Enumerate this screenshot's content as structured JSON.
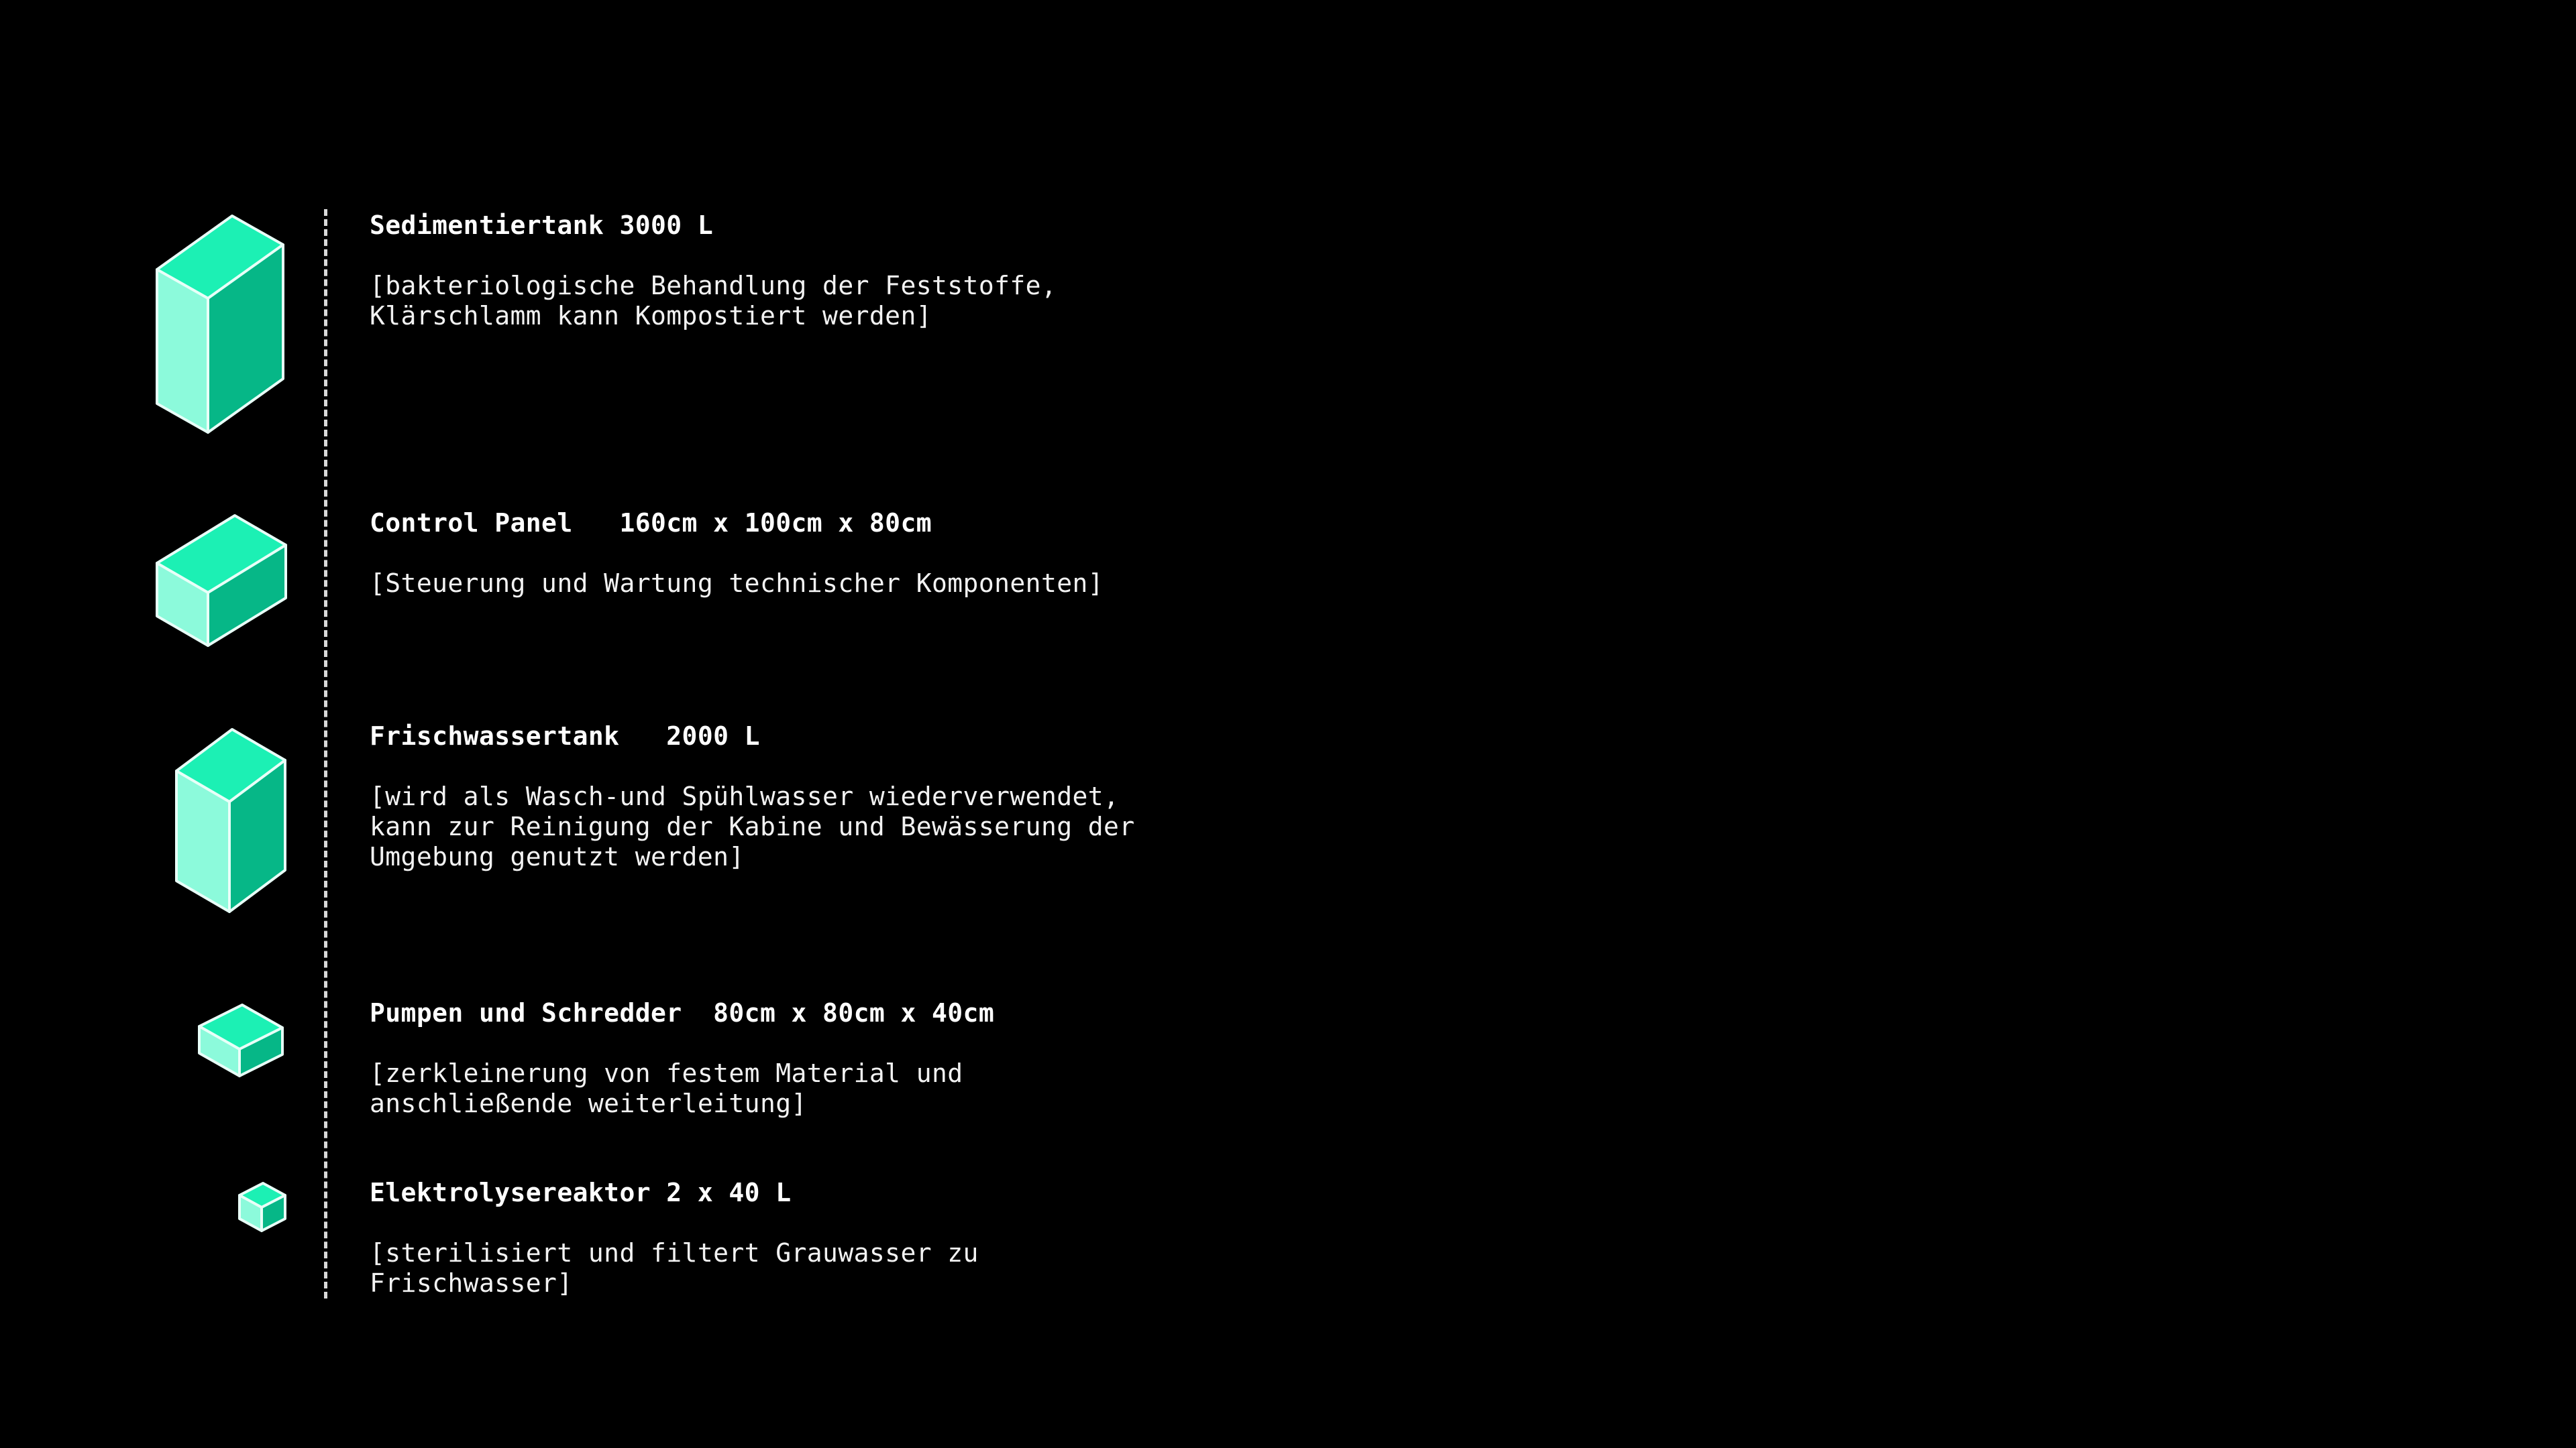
{
  "colors": {
    "background": "#000000",
    "cube_top": "#1cf0b4",
    "cube_left": "#8cfadb",
    "cube_right": "#06b787",
    "cube_edge": "#e8fff8",
    "text": "#ffffff",
    "divider": "#d9d9d9"
  },
  "items": [
    {
      "icon": "tall-box-icon",
      "title": "Sedimentiertank 3000 L",
      "description": "[bakteriologische Behandlung der Feststoffe,\nKlärschlamm kann Kompostiert werden]"
    },
    {
      "icon": "wide-box-icon",
      "title": "Control Panel   160cm x 100cm x 80cm",
      "description": "[Steuerung und Wartung technischer Komponenten]"
    },
    {
      "icon": "tall-box-icon",
      "title": "Frischwassertank   2000 L",
      "description": "[wird als Wasch-und Spühlwasser wiederverwendet,\nkann zur Reinigung der Kabine und Bewässerung der\nUmgebung genutzt werden]"
    },
    {
      "icon": "flat-box-icon",
      "title": "Pumpen und Schredder  80cm x 80cm x 40cm",
      "description": "[zerkleinerung von festem Material und\nanschließende weiterleitung]"
    },
    {
      "icon": "small-cube-icon",
      "title": "Elektrolysereaktor 2 x 40 L",
      "description": "[sterilisiert und filtert Grauwasser zu\nFrischwasser]"
    }
  ]
}
